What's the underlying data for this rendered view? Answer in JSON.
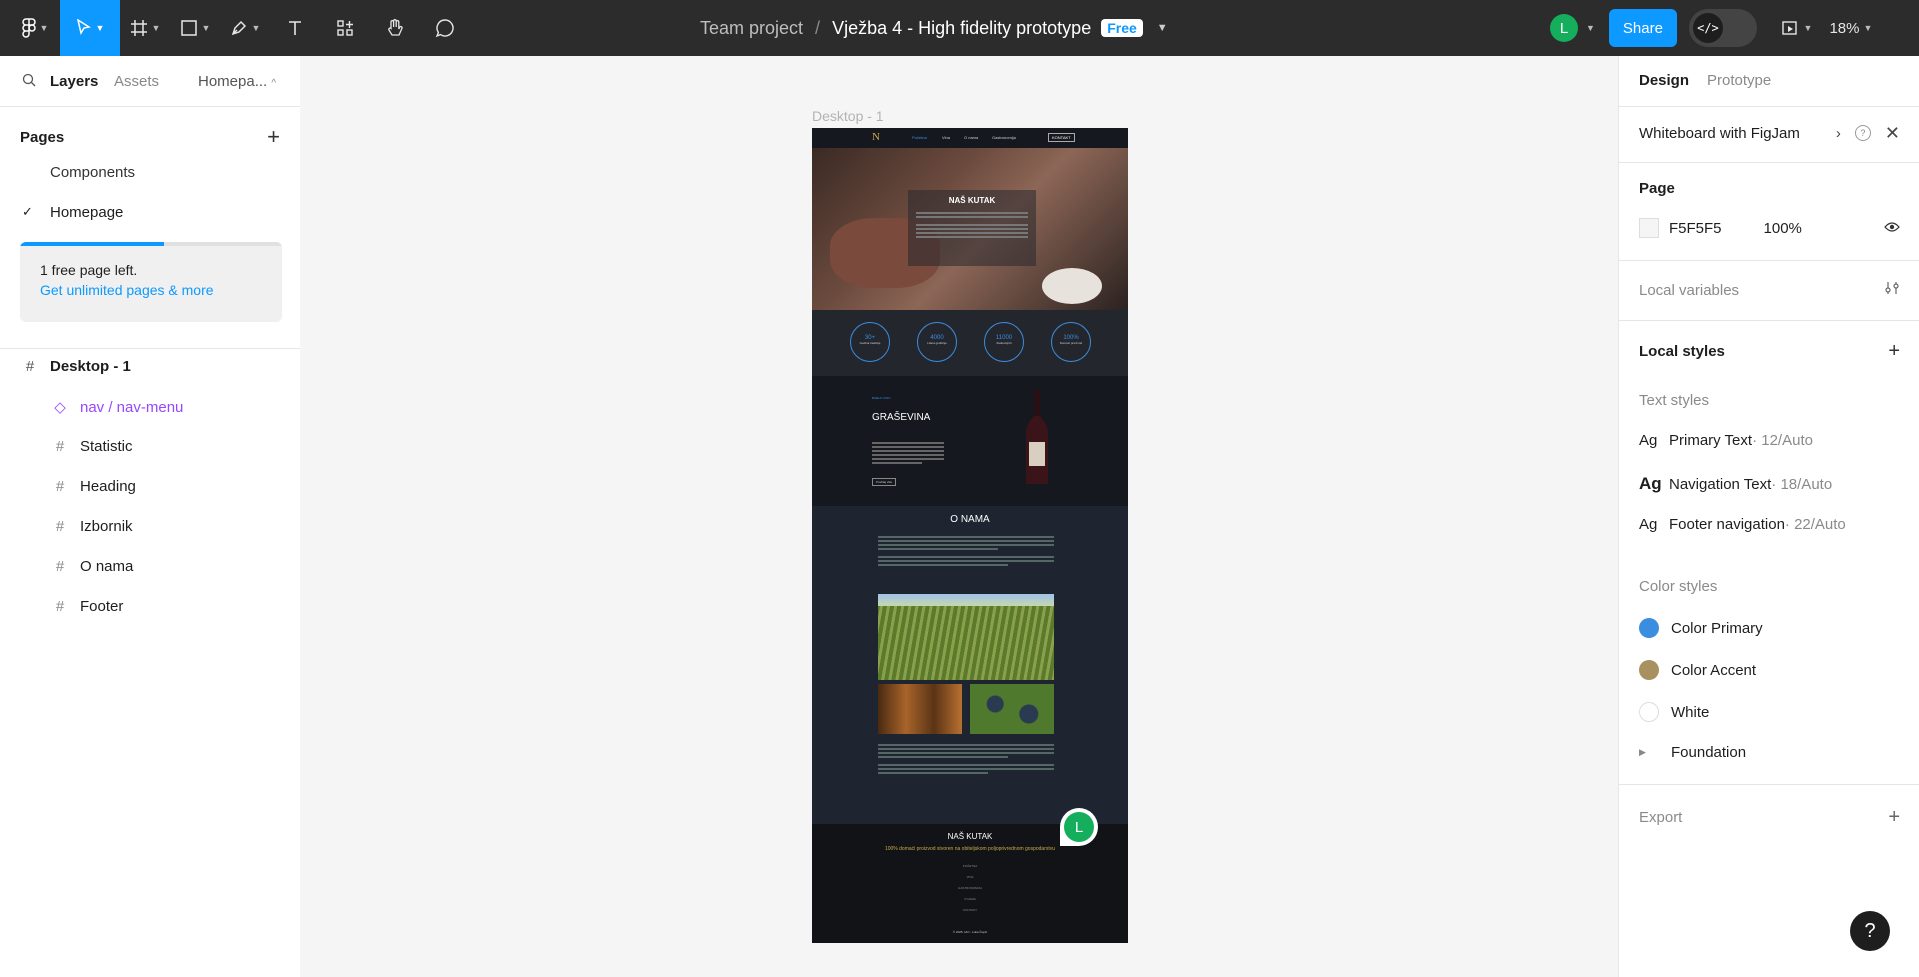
{
  "toolbar": {
    "project": "Team project",
    "separator": "/",
    "file_name": "Vježba 4 - High fidelity prototype",
    "plan_badge": "Free",
    "avatar_initial": "L",
    "share_label": "Share",
    "dev_mode_glyph": "</>",
    "zoom": "18%"
  },
  "left": {
    "tabs": {
      "layers": "Layers",
      "assets": "Assets",
      "page_switch": "Homepa..."
    },
    "pages_title": "Pages",
    "pages": [
      "Components",
      "Homepage"
    ],
    "selected_page_check": "✓",
    "upsell": {
      "text": "1 free page left.",
      "link": "Get unlimited pages & more",
      "progress_percent": 55
    },
    "layers": [
      {
        "name": "Desktop - 1"
      },
      {
        "name": "nav / nav-menu"
      },
      {
        "name": "Statistic"
      },
      {
        "name": "Heading"
      },
      {
        "name": "Izbornik"
      },
      {
        "name": "O nama"
      },
      {
        "name": "Footer"
      }
    ]
  },
  "canvas": {
    "frame_label": "Desktop - 1",
    "logo": "N",
    "nav": [
      "Početna",
      "Vina",
      "O nama",
      "Gastronomija"
    ],
    "nav_cta": "KONTAKT",
    "hero_title": "NAŠ KUTAK",
    "stats": [
      {
        "value": "30+",
        "label": "Godina tradicije"
      },
      {
        "value": "4000",
        "label": "Litara godišnje"
      },
      {
        "value": "11000",
        "label": "Zadovoljnih"
      },
      {
        "value": "100%",
        "label": "Domaći proizvod"
      }
    ],
    "wine_kicker": "BIJELO VINO",
    "wine_title": "GRAŠEVINA",
    "wine_button": "Pročitaj više",
    "about_title": "O NAMA",
    "footer_title": "NAŠ KUTAK",
    "footer_tagline": "100% domaći proizvod stvoren na obiteljskom poljoprivrednom gospodarstvu",
    "footer_links": [
      "POČETNA",
      "VINA",
      "GASTRONOMIJA",
      "O NAMA",
      "KONTAKT"
    ],
    "copyright": "© 2025. HCI - Luka Čupić",
    "comment_avatar": "L"
  },
  "right": {
    "tabs": {
      "design": "Design",
      "prototype": "Prototype"
    },
    "whiteboard": "Whiteboard with FigJam",
    "page_title": "Page",
    "page_fill": "F5F5F5",
    "page_opacity": "100%",
    "local_variables": "Local variables",
    "local_styles": "Local styles",
    "text_styles_title": "Text styles",
    "text_styles": [
      {
        "name": "Primary Text",
        "meta": " · 12/Auto"
      },
      {
        "name": "Navigation Text",
        "meta": " · 18/Auto"
      },
      {
        "name": "Footer navigation",
        "meta": " · 22/Auto"
      }
    ],
    "color_styles_title": "Color styles",
    "color_styles": [
      {
        "name": "Color Primary",
        "color": "#3b8de0"
      },
      {
        "name": "Color Accent",
        "color": "#a89060"
      },
      {
        "name": "White",
        "color": "#ffffff"
      }
    ],
    "foundation": "Foundation",
    "export": "Export",
    "help": "?"
  },
  "colors": {
    "accent": "#0d99ff",
    "toolbar_bg": "#2c2c2c",
    "component_purple": "#9747ff"
  }
}
